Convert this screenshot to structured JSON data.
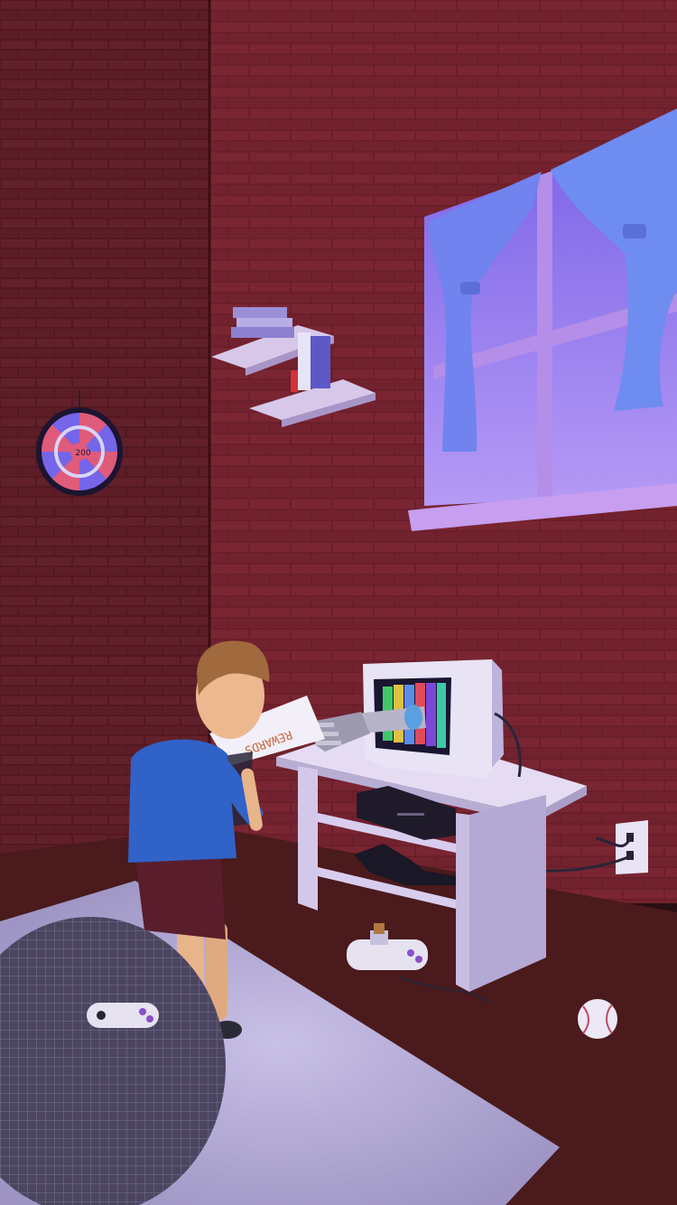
{
  "scene": {
    "dartboard_score_label": "200",
    "paper_text": "REWARDS"
  },
  "palette": {
    "brick": "#6a1f2a",
    "mortar": "#3a0f16",
    "floor": "#4a1a1c",
    "curtain": "#6f7ff0",
    "window_glow": "#8a6ff0",
    "furniture": "#dcd3f0",
    "rug": "#b5abd8"
  }
}
